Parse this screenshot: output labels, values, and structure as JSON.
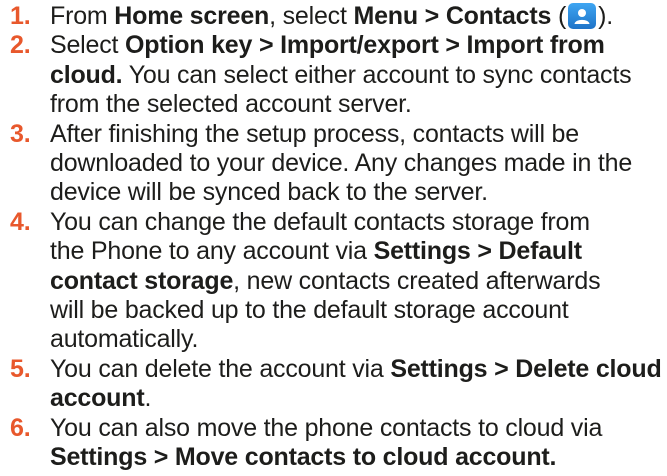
{
  "steps": [
    {
      "num": "1",
      "parts": [
        "From ",
        "Home screen",
        ", select ",
        "Menu > Contacts",
        " (",
        ")."
      ],
      "icon": "contacts-app-icon"
    },
    {
      "num": "2",
      "parts": [
        "Select ",
        "Option key > Import/export > Import from cloud.",
        " You can select either account to sync contacts from the selected account server."
      ]
    },
    {
      "num": "3",
      "parts": [
        "After finishing the setup process, contacts will be downloaded to your device. Any changes made in the device will be synced back to the server."
      ]
    },
    {
      "num": "4",
      "parts": [
        "You can change the default contacts storage from the Phone to any account via ",
        "Settings > Default contact storage",
        ", new contacts created afterwards will be backed up to the default storage account automatically."
      ]
    },
    {
      "num": "5",
      "parts": [
        "You can delete the account via ",
        "Settings > Delete cloud account",
        "."
      ]
    },
    {
      "num": "6",
      "parts": [
        "You can also move the phone contacts to cloud via ",
        "Settings > Move contacts to cloud account."
      ]
    }
  ],
  "colors": {
    "number": "#e8582c",
    "text": "#1d1d1b",
    "icon": "#2a8ee0"
  }
}
